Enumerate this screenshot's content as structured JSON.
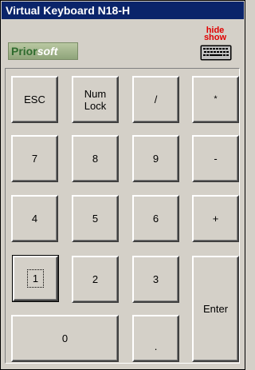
{
  "window": {
    "title": "Virtual Keyboard N18-H"
  },
  "logo": {
    "part1": "Prior",
    "part2": "soft"
  },
  "hideshow": {
    "line1": "hide",
    "line2": "show",
    "icon": "keyboard-icon"
  },
  "keys": {
    "esc": "ESC",
    "numlock_1": "Num",
    "numlock_2": "Lock",
    "slash": "/",
    "star": "*",
    "k7": "7",
    "k8": "8",
    "k9": "9",
    "minus": "-",
    "k4": "4",
    "k5": "5",
    "k6": "6",
    "plus": "+",
    "k1": "1",
    "k2": "2",
    "k3": "3",
    "enter": "Enter",
    "k0": "0",
    "dot": "."
  },
  "colors": {
    "titlebar": "#0a246a",
    "face": "#d4d0c8",
    "hide_show": "#e00000"
  }
}
